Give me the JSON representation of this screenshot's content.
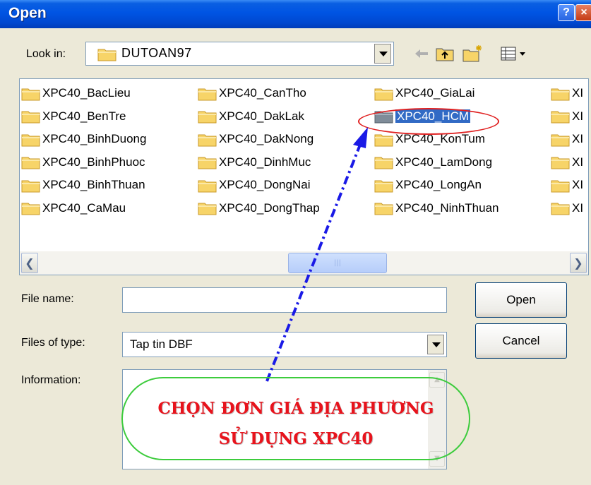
{
  "window": {
    "title": "Open",
    "help_label": "?",
    "close_label": "×"
  },
  "lookin": {
    "label": "Look in:",
    "value": "DUTOAN97"
  },
  "files": [
    {
      "name": "XPC40_BacLieu"
    },
    {
      "name": "XPC40_BenTre"
    },
    {
      "name": "XPC40_BinhDuong"
    },
    {
      "name": "XPC40_BinhPhuoc"
    },
    {
      "name": "XPC40_BinhThuan"
    },
    {
      "name": "XPC40_CaMau"
    },
    {
      "name": "XPC40_CanTho"
    },
    {
      "name": "XPC40_DakLak"
    },
    {
      "name": "XPC40_DakNong"
    },
    {
      "name": "XPC40_DinhMuc"
    },
    {
      "name": "XPC40_DongNai"
    },
    {
      "name": "XPC40_DongThap"
    },
    {
      "name": "XPC40_GiaLai"
    },
    {
      "name": "XPC40_HCM",
      "selected": true
    },
    {
      "name": "XPC40_KonTum"
    },
    {
      "name": "XPC40_LamDong"
    },
    {
      "name": "XPC40_LongAn"
    },
    {
      "name": "XPC40_NinhThuan"
    },
    {
      "name": "XI"
    },
    {
      "name": "XI"
    },
    {
      "name": "XI"
    },
    {
      "name": "XI"
    },
    {
      "name": "XI"
    },
    {
      "name": "XI"
    }
  ],
  "scroll": {
    "thumb_grip": "|||"
  },
  "form": {
    "filename_label": "File name:",
    "filename_value": "",
    "filetype_label": "Files of type:",
    "filetype_value": "Tap tin DBF",
    "information_label": "Information:"
  },
  "buttons": {
    "open_label": "Open",
    "cancel_label": "Cancel"
  },
  "annotation": {
    "line1": "CHỌN ĐƠN GIÁ ĐỊA PHƯƠNG",
    "line2": "SỬ DỤNG XPC40"
  },
  "colors": {
    "accent": "#0054e3",
    "selection": "#316ac5",
    "annotation_text": "#e8131c",
    "annotation_oval": "#3dcc3d",
    "arrow": "#1a1ae6"
  }
}
